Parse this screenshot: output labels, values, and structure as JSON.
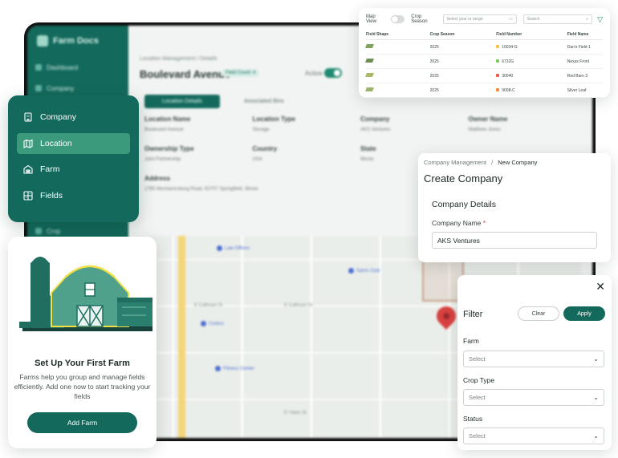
{
  "background_app": {
    "brand": "Farm Docs",
    "nav": [
      "Dashboard",
      "Company",
      "Crop"
    ],
    "breadcrumb": "Location Management  /  Details",
    "title": "Boulevard Avenue",
    "badge": "Field Count: 4",
    "active_label": "Active",
    "tabs": [
      "Location Details",
      "Associated Bins"
    ],
    "fields": [
      {
        "label": "Location Name",
        "value": "Boulevard Avenue"
      },
      {
        "label": "Location Type",
        "value": "Storage"
      },
      {
        "label": "Company",
        "value": "AKS Ventures"
      },
      {
        "label": "Owner Name",
        "value": "Matthew Jones"
      },
      {
        "label": "Ownership Type",
        "value": "Joint Partnership"
      },
      {
        "label": "Country",
        "value": "USA"
      },
      {
        "label": "State",
        "value": "Illinois"
      },
      {
        "label": "",
        "value": ""
      }
    ],
    "address_label": "Address",
    "address_value": "1785 Mechanicsburg Road, 62707 Springfield, Illinois",
    "map": {
      "pois": [
        "Costco",
        "Fitness Center",
        "Sams Club",
        "Law Offices"
      ],
      "streets": [
        "E Calhoun St",
        "E Calhoun St",
        "E Yates St"
      ]
    }
  },
  "table_card": {
    "map_view_label": "Map View",
    "crop_season_label": "Crop Season",
    "crop_season_placeholder": "Select year or range",
    "search_placeholder": "Search",
    "columns": [
      "Field Shape",
      "Crop Season",
      "Field Number",
      "Field Name"
    ],
    "rows": [
      {
        "season": "2025",
        "number": "10034-G",
        "name": "Dan's Field 1",
        "color": "#f2c33d"
      },
      {
        "season": "2025",
        "number": "6732G",
        "name": "Nexus Front",
        "color": "#7cc95a"
      },
      {
        "season": "2025",
        "number": "30040",
        "name": "Red Barn 3",
        "color": "#f05a4f"
      },
      {
        "season": "2025",
        "number": "9008-C",
        "name": "Silver Leaf",
        "color": "#f28a3d"
      }
    ]
  },
  "nav_card": {
    "items": [
      {
        "label": "Company",
        "icon": "building-icon"
      },
      {
        "label": "Location",
        "icon": "map-icon"
      },
      {
        "label": "Farm",
        "icon": "barn-icon"
      },
      {
        "label": "Fields",
        "icon": "fields-icon"
      }
    ],
    "active": "Location"
  },
  "farm_card": {
    "title": "Set Up Your First Farm",
    "description": "Farms help you group and manage fields efficiently. Add one now to start tracking your fields",
    "button": "Add Farm"
  },
  "company_card": {
    "breadcrumb_parent": "Company Management",
    "breadcrumb_separator": "/",
    "breadcrumb_current": "New Company",
    "title": "Create Company",
    "section": "Company Details",
    "field_label": "Company Name",
    "required_mark": "*",
    "field_value": "AKS Ventures"
  },
  "filter_card": {
    "title": "Filter",
    "clear": "Clear",
    "apply": "Apply",
    "close": "✕",
    "groups": [
      {
        "label": "Farm",
        "placeholder": "Select"
      },
      {
        "label": "Crop Type",
        "placeholder": "Select"
      },
      {
        "label": "Status",
        "placeholder": "Select"
      }
    ]
  },
  "colors": {
    "brand": "#136a5c",
    "brand_light": "#3a9a7b",
    "pin": "#d94141"
  }
}
